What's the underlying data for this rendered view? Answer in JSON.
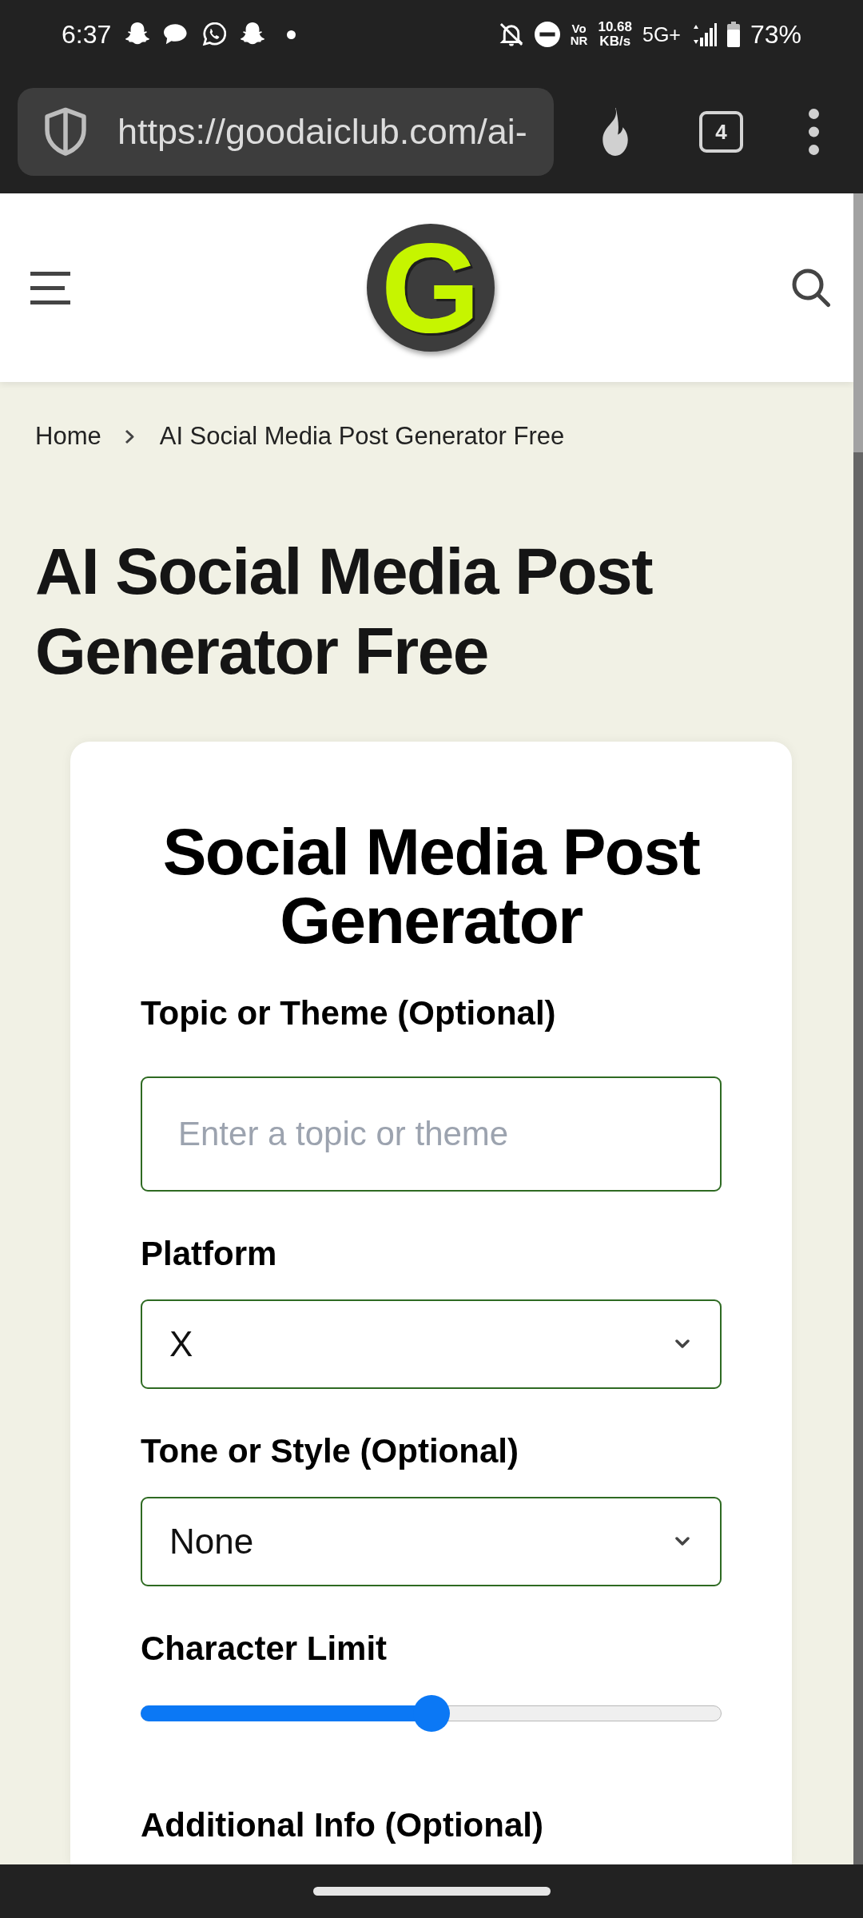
{
  "status_bar": {
    "time": "6:37",
    "voice_badge": {
      "top": "Vo",
      "bottom": "NR"
    },
    "net_speed": {
      "value": "10.68",
      "unit": "KB/s"
    },
    "network": "5G+",
    "battery": "73%"
  },
  "browser_bar": {
    "url": "https://goodaiclub.com/ai-",
    "tab_count": "4"
  },
  "site_header": {
    "logo": "G"
  },
  "breadcrumb": [
    {
      "label": "Home"
    },
    {
      "label": "AI Social Media Post Generator Free"
    }
  ],
  "page_title": "AI Social Media Post Generator Free",
  "generator": {
    "title": "Social Media Post Generator",
    "fields": [
      {
        "kind": "text",
        "label": "Topic or Theme (Optional)",
        "placeholder": "Enter a topic or theme"
      },
      {
        "kind": "select",
        "label": "Platform",
        "value": "X"
      },
      {
        "kind": "select",
        "label": "Tone or Style (Optional)",
        "value": "None"
      },
      {
        "kind": "slider",
        "label": "Character Limit",
        "level": 0.5
      },
      {
        "kind": "label",
        "label": "Additional Info (Optional)"
      }
    ]
  }
}
